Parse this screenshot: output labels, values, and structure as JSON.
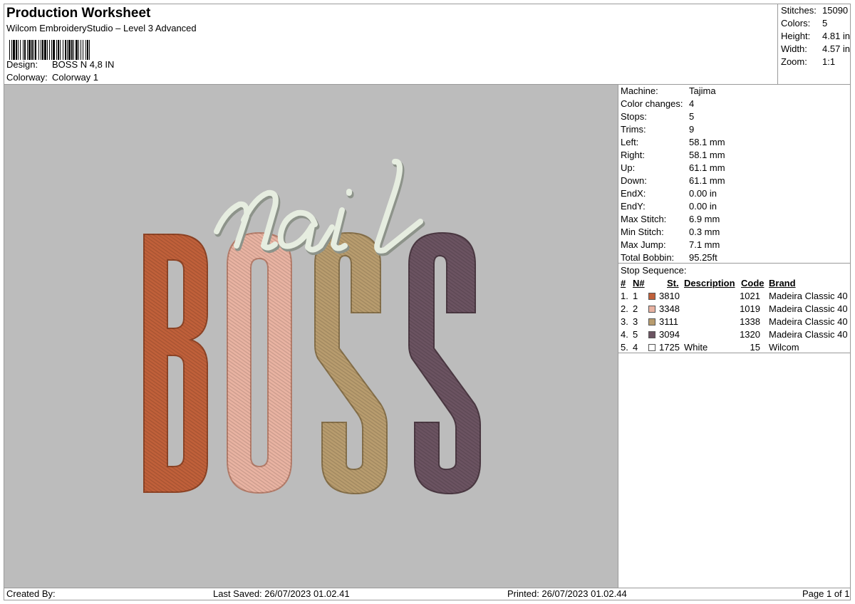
{
  "header": {
    "title": "Production Worksheet",
    "subtitle": "Wilcom EmbroideryStudio – Level 3 Advanced",
    "design_label": "Design:",
    "design_value": "BOSS N 4,8 IN",
    "colorway_label": "Colorway:",
    "colorway_value": "Colorway 1"
  },
  "stats": [
    {
      "label": "Stitches:",
      "value": "15090"
    },
    {
      "label": "Colors:",
      "value": "5"
    },
    {
      "label": "Height:",
      "value": "4.81 in"
    },
    {
      "label": "Width:",
      "value": "4.57 in"
    },
    {
      "label": "Zoom:",
      "value": "1:1"
    }
  ],
  "machine_info": [
    {
      "label": "Machine:",
      "value": "Tajima"
    },
    {
      "label": "Color changes:",
      "value": "4"
    },
    {
      "label": "Stops:",
      "value": "5"
    },
    {
      "label": "Trims:",
      "value": "9"
    },
    {
      "label": "Left:",
      "value": "58.1 mm"
    },
    {
      "label": "Right:",
      "value": "58.1 mm"
    },
    {
      "label": "Up:",
      "value": "61.1 mm"
    },
    {
      "label": "Down:",
      "value": "61.1 mm"
    },
    {
      "label": "EndX:",
      "value": "0.00 in"
    },
    {
      "label": "EndY:",
      "value": "0.00 in"
    },
    {
      "label": "Max Stitch:",
      "value": "6.9 mm"
    },
    {
      "label": "Min Stitch:",
      "value": "0.3 mm"
    },
    {
      "label": "Max Jump:",
      "value": "7.1 mm"
    },
    {
      "label": "Total Bobbin:",
      "value": "95.25ft"
    }
  ],
  "stop_sequence": {
    "title": "Stop Sequence:",
    "headers": {
      "num": "#",
      "n": "N#",
      "st": "St.",
      "description": "Description",
      "code": "Code",
      "brand": "Brand"
    },
    "rows": [
      {
        "num": "1.",
        "n": "1",
        "color": "#c0603a",
        "st": "3810",
        "description": "",
        "code": "1021",
        "brand": "Madeira Classic 40"
      },
      {
        "num": "2.",
        "n": "2",
        "color": "#e9b3a2",
        "st": "3348",
        "description": "",
        "code": "1019",
        "brand": "Madeira Classic 40"
      },
      {
        "num": "3.",
        "n": "3",
        "color": "#b89c6e",
        "st": "3111",
        "description": "",
        "code": "1338",
        "brand": "Madeira Classic 40"
      },
      {
        "num": "4.",
        "n": "5",
        "color": "#6b5361",
        "st": "3094",
        "description": "",
        "code": "1320",
        "brand": "Madeira Classic 40"
      },
      {
        "num": "5.",
        "n": "4",
        "color": "#ffffff",
        "st": "1725",
        "description": "White",
        "code": "15",
        "brand": "Wilcom"
      }
    ]
  },
  "design_preview": {
    "script_word": "nail",
    "block_letters": [
      "B",
      "O",
      "S",
      "S"
    ],
    "colors": {
      "b": "#c0603a",
      "o": "#e9b3a2",
      "s1": "#b89c6e",
      "s2": "#6b5361",
      "script": "#e6ede0",
      "background": "#bcbcbc"
    }
  },
  "footer": {
    "created_by": "Created By:",
    "last_saved": "Last Saved: 26/07/2023 01.02.41",
    "printed": "Printed: 26/07/2023 01.02.44",
    "page": "Page 1 of 1"
  }
}
